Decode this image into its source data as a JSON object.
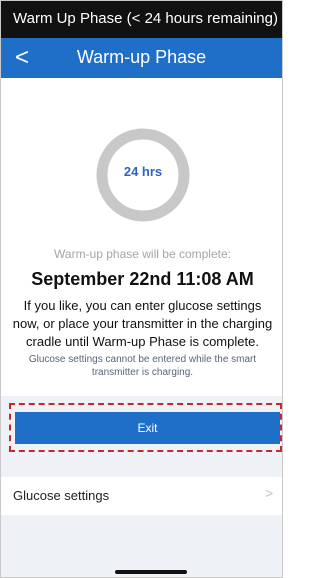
{
  "status_bar": {
    "text": "Warm Up Phase (< 24 hours remaining)"
  },
  "nav": {
    "back_icon": "chevron-left-icon",
    "back_glyph": "<",
    "title": "Warm-up Phase"
  },
  "timer": {
    "label": "24 hrs"
  },
  "message": {
    "line1": "Warm-up phase will be complete:",
    "datetime": "September 22nd 11:08 AM",
    "instructions": "If you like, you can enter glucose settings now, or place your transmitter in the charging cradle until Warm-up Phase is complete.",
    "note": "Glucose settings cannot be entered while the smart transmitter is charging."
  },
  "exit_button": {
    "label": "Exit"
  },
  "settings_row": {
    "label": "Glucose settings",
    "chevron_glyph": ">",
    "chevron_icon": "chevron-right-icon"
  },
  "colors": {
    "accent": "#1f6fc8",
    "ring": "#c8c8c8",
    "timer_text": "#2e65b8",
    "highlight": "#c42a2a",
    "status_bar": "#111111"
  }
}
